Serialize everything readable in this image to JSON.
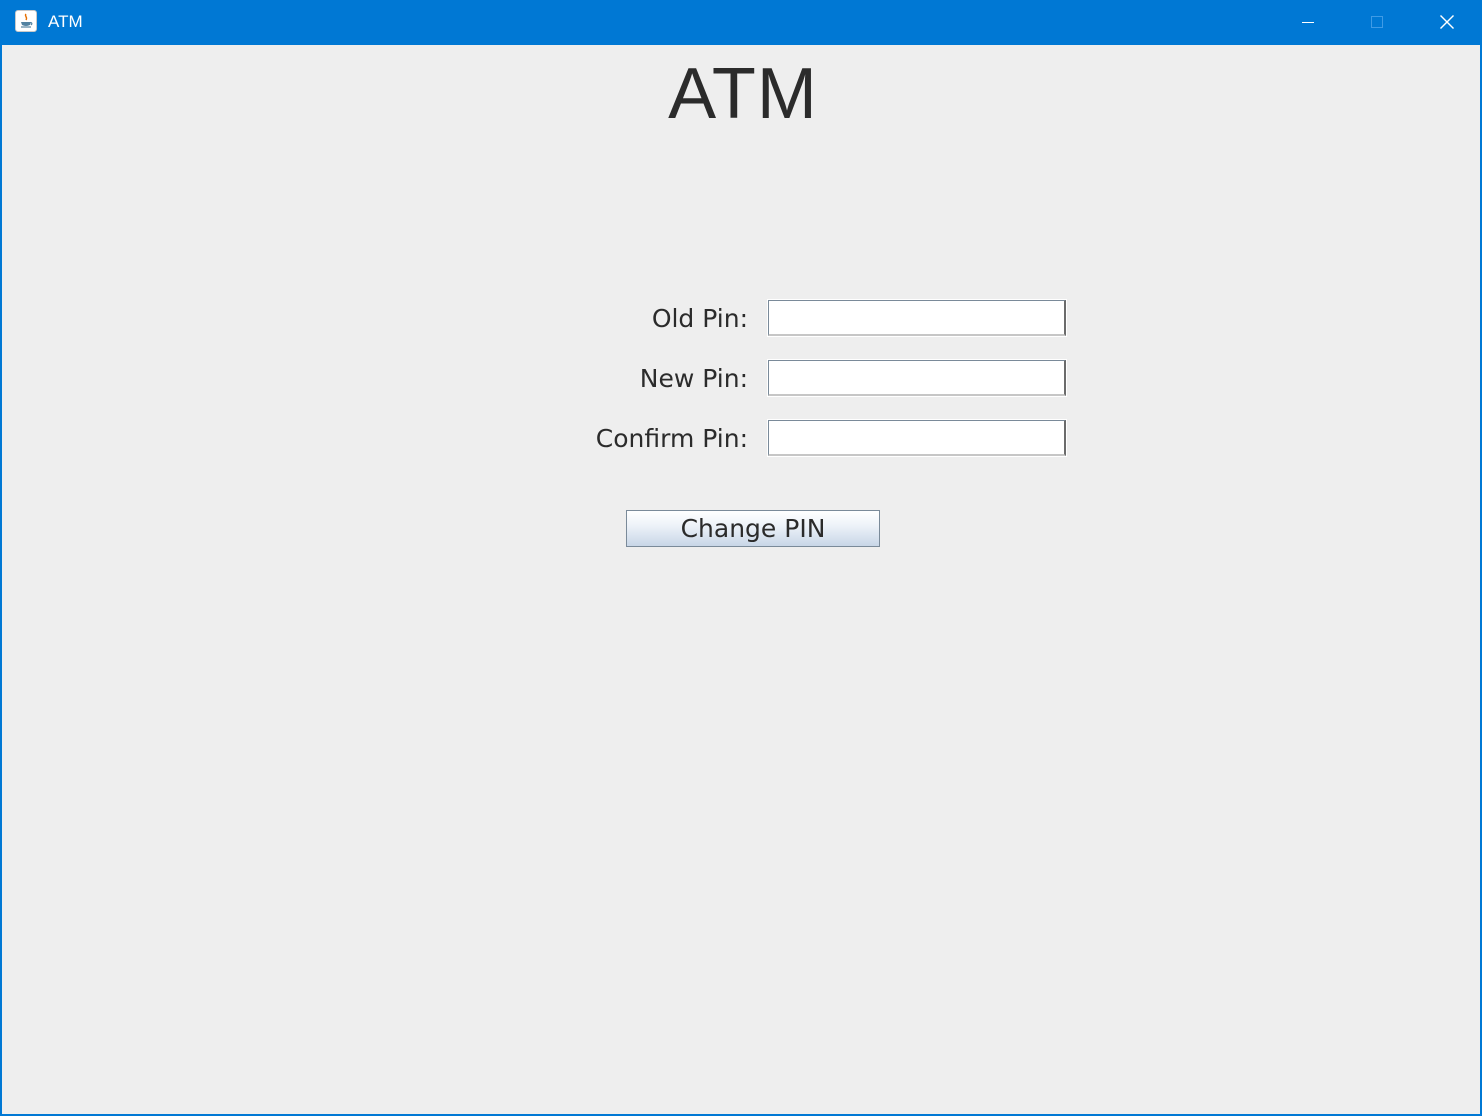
{
  "window": {
    "title": "ATM"
  },
  "titlebar_icons": {
    "app": "java-app-icon",
    "minimize": "minimize-icon",
    "maximize": "maximize-icon",
    "close": "close-icon"
  },
  "main": {
    "heading": "ATM",
    "fields": [
      {
        "label": "Old Pin:",
        "value": "",
        "placeholder": ""
      },
      {
        "label": "New Pin:",
        "value": "",
        "placeholder": ""
      },
      {
        "label": "Confirm Pin:",
        "value": "",
        "placeholder": ""
      }
    ],
    "submit_label": "Change PIN"
  },
  "colors": {
    "titlebar": "#0078d4",
    "background": "#eeeeee",
    "text": "#2b2b2b"
  }
}
